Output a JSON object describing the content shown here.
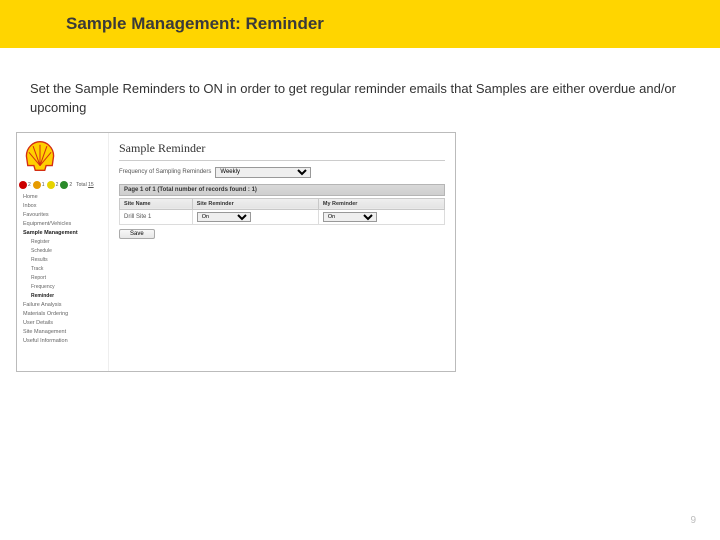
{
  "title": "Sample Management: Reminder",
  "body": "Set the Sample Reminders to ON in order to get regular reminder emails that Samples are either overdue and/or upcoming",
  "status": {
    "red": "2",
    "orange": "1",
    "yellow": "2",
    "green": "2",
    "total_label": "Total",
    "total_value": "15"
  },
  "nav": {
    "home": "Home",
    "inbox": "Inbox",
    "favourites": "Favourites",
    "equipment": "Equipment/Vehicles",
    "sample_mgmt": "Sample Management",
    "register": "Register",
    "schedule": "Schedule",
    "results": "Results",
    "track": "Track",
    "report": "Report",
    "frequency": "Frequency",
    "reminder": "Reminder",
    "failure": "Failure Analysis",
    "materials": "Materials Ordering",
    "user_details": "User Details",
    "site_mgmt": "Site Management",
    "useful": "Useful Information"
  },
  "panel": {
    "title": "Sample Reminder",
    "freq_label": "Frequency of Sampling Reminders",
    "freq_value": "Weekly",
    "pager": "Page 1 of 1 (Total number of records found : 1)",
    "cols": {
      "site": "Site Name",
      "site_rem": "Site Reminder",
      "my_rem": "My Reminder"
    },
    "row": {
      "site": "Drill Site 1",
      "site_rem": "On",
      "my_rem": "On"
    },
    "save": "Save"
  },
  "page_number": "9"
}
